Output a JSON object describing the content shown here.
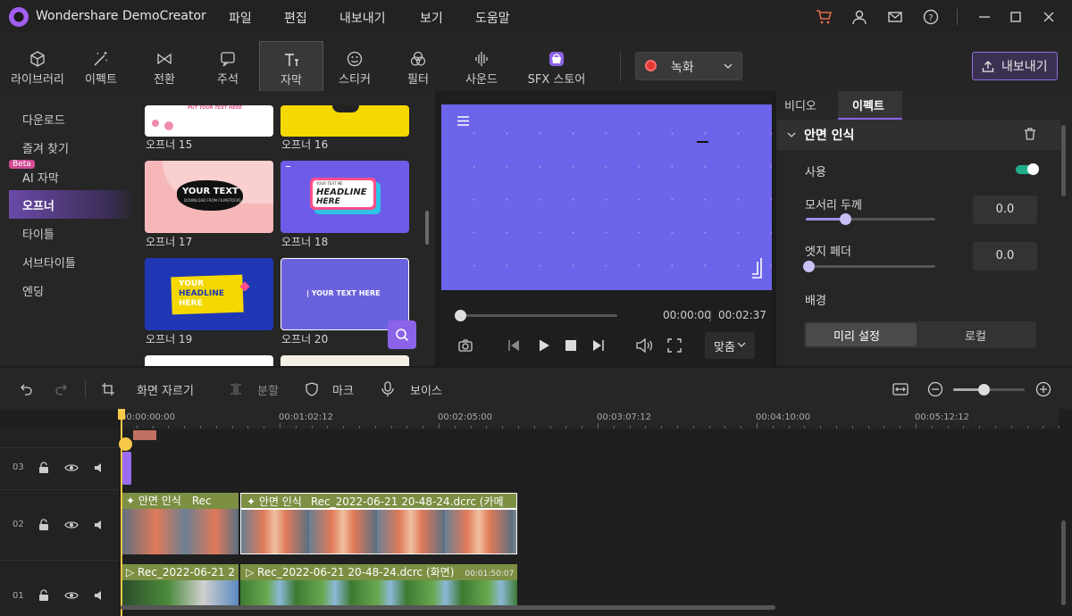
{
  "app": {
    "title": "Wondershare DemoCreator"
  },
  "menu": {
    "file": "파일",
    "edit": "편집",
    "export": "내보내기",
    "view": "보기",
    "help": "도움말"
  },
  "tabs": [
    {
      "label": "라이브러리",
      "icon": "cube-icon"
    },
    {
      "label": "이펙트",
      "icon": "magic-wand-icon"
    },
    {
      "label": "전환",
      "icon": "transition-icon"
    },
    {
      "label": "주석",
      "icon": "annotation-icon"
    },
    {
      "label": "자막",
      "icon": "text-icon"
    },
    {
      "label": "스티커",
      "icon": "smiley-icon"
    },
    {
      "label": "필터",
      "icon": "filter-icon"
    },
    {
      "label": "사운드",
      "icon": "sound-wave-icon"
    },
    {
      "label": "SFX 스토어",
      "icon": "store-icon"
    }
  ],
  "record": {
    "label": "녹화"
  },
  "export_button": {
    "label": "내보내기"
  },
  "categories": [
    "다운로드",
    "즐겨 찾기",
    "AI 자막",
    "오프너",
    "타이틀",
    "서브타이틀",
    "엔딩"
  ],
  "beta_badge": "Beta",
  "templates": {
    "t15": "오프너 15",
    "t16": "오프너 16",
    "t17": "오프너 17",
    "t18": "오프너 18",
    "t19": "오프너 19",
    "t20": "오프너 20",
    "t15_text": "PUT YOUR TEXT HERE",
    "t17_title": "YOUR TEXT",
    "t17_sub": "DOWNLOAD FROM FILMSTOCKS",
    "t18_small": "YOUR TEXT ME",
    "t18_line1": "HEADLINE",
    "t18_line2": "HERE",
    "t19_line1": "YOUR",
    "t19_line2": "HEADLINE",
    "t19_line3": "HERE",
    "t20_text": "| YOUR TEXT HERE"
  },
  "player": {
    "current": "00:00:00",
    "separator": "|",
    "total": "00:02:37",
    "fit": "맞춤"
  },
  "right_tabs": {
    "video": "비디오",
    "effect": "이펙트"
  },
  "effect": {
    "section": "안면 인식",
    "use_label": "사용",
    "use_enabled": true,
    "edge_thickness": {
      "label": "모서리 두께",
      "value": "0.0",
      "level": 0.3
    },
    "edge_feather": {
      "label": "엣지 페더",
      "value": "0.0",
      "level": 0.0
    },
    "background": {
      "label": "배경",
      "options": [
        "미리 설정",
        "로컬"
      ],
      "selected": "미리 설정"
    }
  },
  "toolbar": {
    "crop": "화면 자르기",
    "split": "분할",
    "mark": "마크",
    "voice": "보이스"
  },
  "ruler": [
    "00:00:00:00",
    "00:01:02:12",
    "00:02:05:00",
    "00:03:07:12",
    "00:04:10:00",
    "00:05:12:12"
  ],
  "tracks": [
    "03",
    "02",
    "01"
  ],
  "clips": {
    "fx_a": "안면 인식",
    "fx_a_name": "Rec",
    "fx_b": "안면 인식",
    "fx_b_name": "Rec_2022-06-21 20-48-24.dcrc (카메",
    "v_a": "Rec_2022-06-21 2",
    "v_b": "Rec_2022-06-21 20-48-24.dcrc (화면)",
    "v_b_duration": "00:01:50:07"
  },
  "colors": {
    "accent": "#8b63e8",
    "canvas": "#6c64ea",
    "clip_header": "#7c8f43",
    "record": "#e53935",
    "playhead": "#f7c948",
    "toggle_on": "#1fae8a"
  }
}
